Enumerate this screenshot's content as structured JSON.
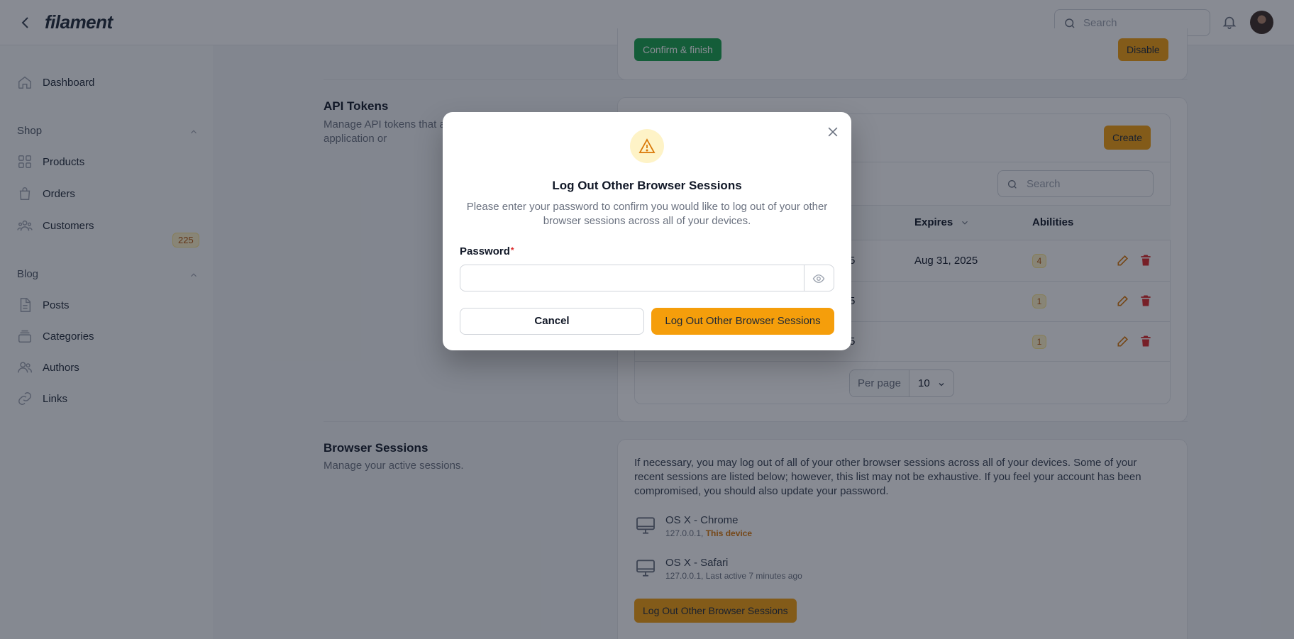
{
  "app": {
    "brand": "filament"
  },
  "header": {
    "search_placeholder": "Search"
  },
  "sidebar": {
    "dashboard": "Dashboard",
    "shop_group": "Shop",
    "products": "Products",
    "orders": "Orders",
    "orders_badge": "225",
    "customers": "Customers",
    "blog_group": "Blog",
    "posts": "Posts",
    "categories": "Categories",
    "authors": "Authors",
    "links": "Links"
  },
  "two_factor": {
    "confirm_label": "Confirm & finish",
    "disable_label": "Disable"
  },
  "api_tokens": {
    "title": "API Tokens",
    "description": "Manage API tokens that a access this application or",
    "create_label": "Create",
    "search_placeholder": "Search",
    "columns": {
      "expires": "Expires",
      "abilities": "Abilities"
    },
    "rows": [
      {
        "partial": "5",
        "expires": "Aug 31, 2025",
        "abilities": "4"
      },
      {
        "partial": "5",
        "expires": "",
        "abilities": "1"
      },
      {
        "partial": "5",
        "expires": "",
        "abilities": "1"
      }
    ],
    "per_page_label": "Per page",
    "per_page_value": "10"
  },
  "browser_sessions": {
    "title": "Browser Sessions",
    "description": "Manage your active sessions.",
    "text": "If necessary, you may log out of all of your other browser sessions across all of your devices. Some of your recent sessions are listed below; however, this list may not be exhaustive. If you feel your account has been compromised, you should also update your password.",
    "sessions": [
      {
        "name": "OS X - Chrome",
        "ip": "127.0.0.1, ",
        "status": "This device"
      },
      {
        "name": "OS X - Safari",
        "ip": "127.0.0.1, ",
        "status": "Last active 7 minutes ago"
      }
    ],
    "logout_label": "Log Out Other Browser Sessions"
  },
  "modal": {
    "title": "Log Out Other Browser Sessions",
    "description": "Please enter your password to confirm you would like to log out of your other browser sessions across all of your devices.",
    "password_label": "Password",
    "required_mark": "*",
    "password_value": "",
    "cancel_label": "Cancel",
    "confirm_label": "Log Out Other Browser Sessions"
  },
  "colors": {
    "primary": "#f59e0b",
    "success": "#16a34a",
    "danger": "#dc2626",
    "badge_bg": "#fef3c7"
  }
}
